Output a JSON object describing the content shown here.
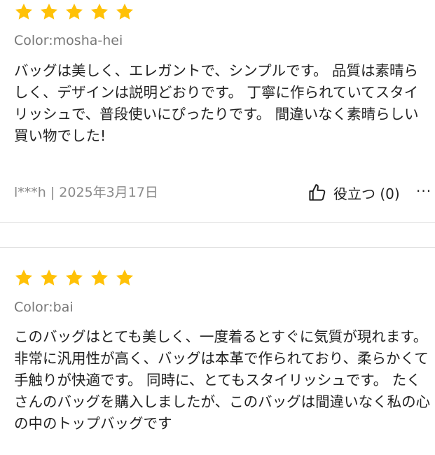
{
  "reviews": [
    {
      "rating": 5,
      "color_label": "Color:mosha-hei",
      "text": "バッグは美しく、エレガントで、シンプルです。 品質は素晴らしく、デザインは説明どおりです。 丁寧に作られていてスタイリッシュで、普段使いにぴったりです。 間違いなく素晴らしい買い物でした!",
      "author_date": "l***h | 2025年3月17日",
      "helpful_label": "役立つ (0)",
      "more_label": "···"
    },
    {
      "rating": 5,
      "color_label": "Color:bai",
      "text": "このバッグはとても美しく、一度着るとすぐに気質が現れます。 非常に汎用性が高く、バッグは本革で作られており、柔らかくて手触りが快適です。 同時に、とてもスタイリッシュです。 たくさんのバッグを購入しましたが、このバッグは間違いなく私の心の中のトップバッグです"
    }
  ],
  "colors": {
    "star": "#FFC107",
    "muted_text": "#777777",
    "divider": "#E2E2E2"
  },
  "icons": {
    "star": "star-icon",
    "helpful": "thumbs-up-icon",
    "more": "more-options-icon"
  }
}
